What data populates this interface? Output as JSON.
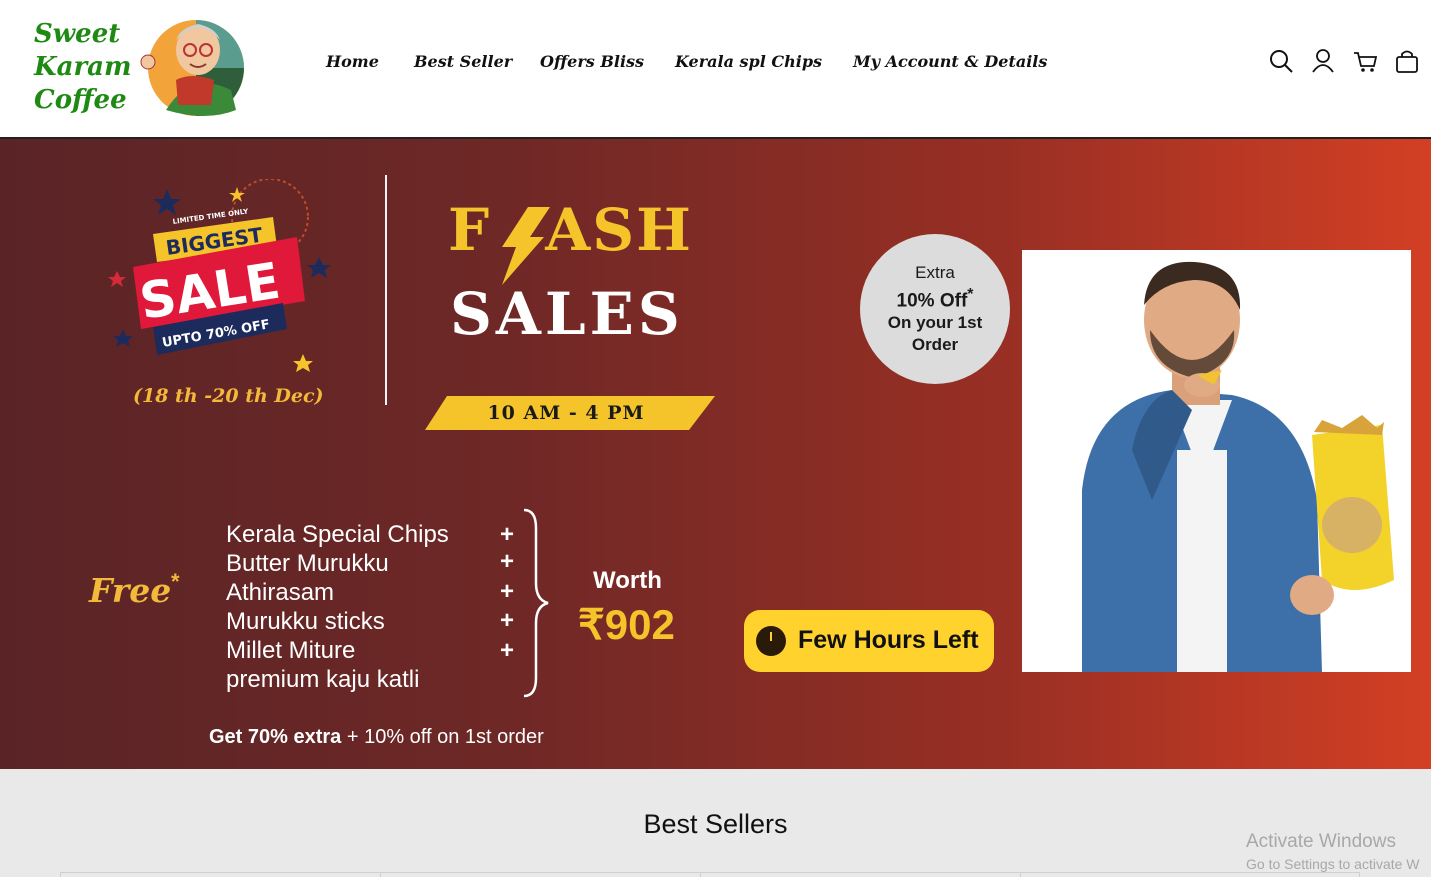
{
  "brand": {
    "line1": "Sweet",
    "line2": "Karam",
    "line3": "Coffee"
  },
  "nav": {
    "home": "Home",
    "best_seller": "Best Seller",
    "offers": "Offers Bliss",
    "kerala": "Kerala spl Chips",
    "account": "My Account & Details"
  },
  "header_icons": [
    "search-icon",
    "user-icon",
    "cart-icon",
    "bag-icon"
  ],
  "badge": {
    "limited": "LIMITED TIME ONLY",
    "biggest": "BIGGEST",
    "sale": "SALE",
    "upto": "UPTO 70% OFF"
  },
  "dates": "(18 th -20 th Dec)",
  "flash": {
    "f": "F",
    "ash": "ASH",
    "sales": "SALES",
    "time": "10 AM - 4 PM"
  },
  "extra": {
    "line1": "Extra",
    "line2": "10% Off",
    "star": "*",
    "line3": "On your 1st",
    "line4": "Order"
  },
  "free": {
    "label": "Free",
    "star": "*",
    "items": [
      "Kerala Special Chips",
      "Butter Murukku",
      "Athirasam",
      "Murukku sticks",
      "Millet Miture",
      "premium kaju katli"
    ],
    "plus": "+"
  },
  "worth": {
    "label": "Worth",
    "price": "₹902"
  },
  "cta": {
    "label": "Few Hours Left"
  },
  "offer": {
    "bold": "Get 70% extra",
    "rest": " + 10% off on 1st order"
  },
  "best_sellers": {
    "title": "Best Sellers"
  },
  "watermark": {
    "line1": "Activate Windows",
    "line2": "Go to Settings to activate W"
  },
  "colors": {
    "brand_green": "#1f8a13",
    "accent_yellow": "#f5c42a",
    "banner_dark": "#5a2426",
    "banner_light": "#d33f24"
  }
}
